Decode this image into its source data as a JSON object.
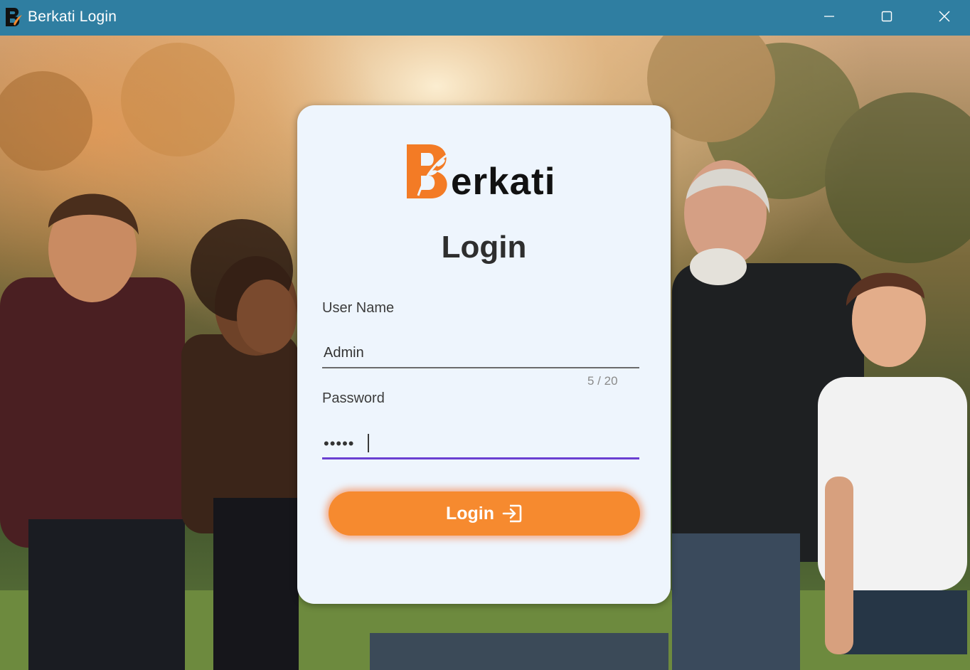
{
  "window": {
    "title": "Berkati Login",
    "titlebar_color": "#2f7ea1",
    "controls": [
      "minimize-icon",
      "maximize-icon",
      "close-icon"
    ]
  },
  "brand": {
    "logo_text": "erkati",
    "logo_letter": "B",
    "accent_color": "#f68a2f"
  },
  "login": {
    "title": "Login",
    "username_label": "User Name",
    "username_value": "Admin",
    "username_counter": "5 / 20",
    "password_label": "Password",
    "password_value": "•••••",
    "button_label": "Login",
    "button_icon": "login-icon",
    "focus_color": "#6a3fd1"
  }
}
